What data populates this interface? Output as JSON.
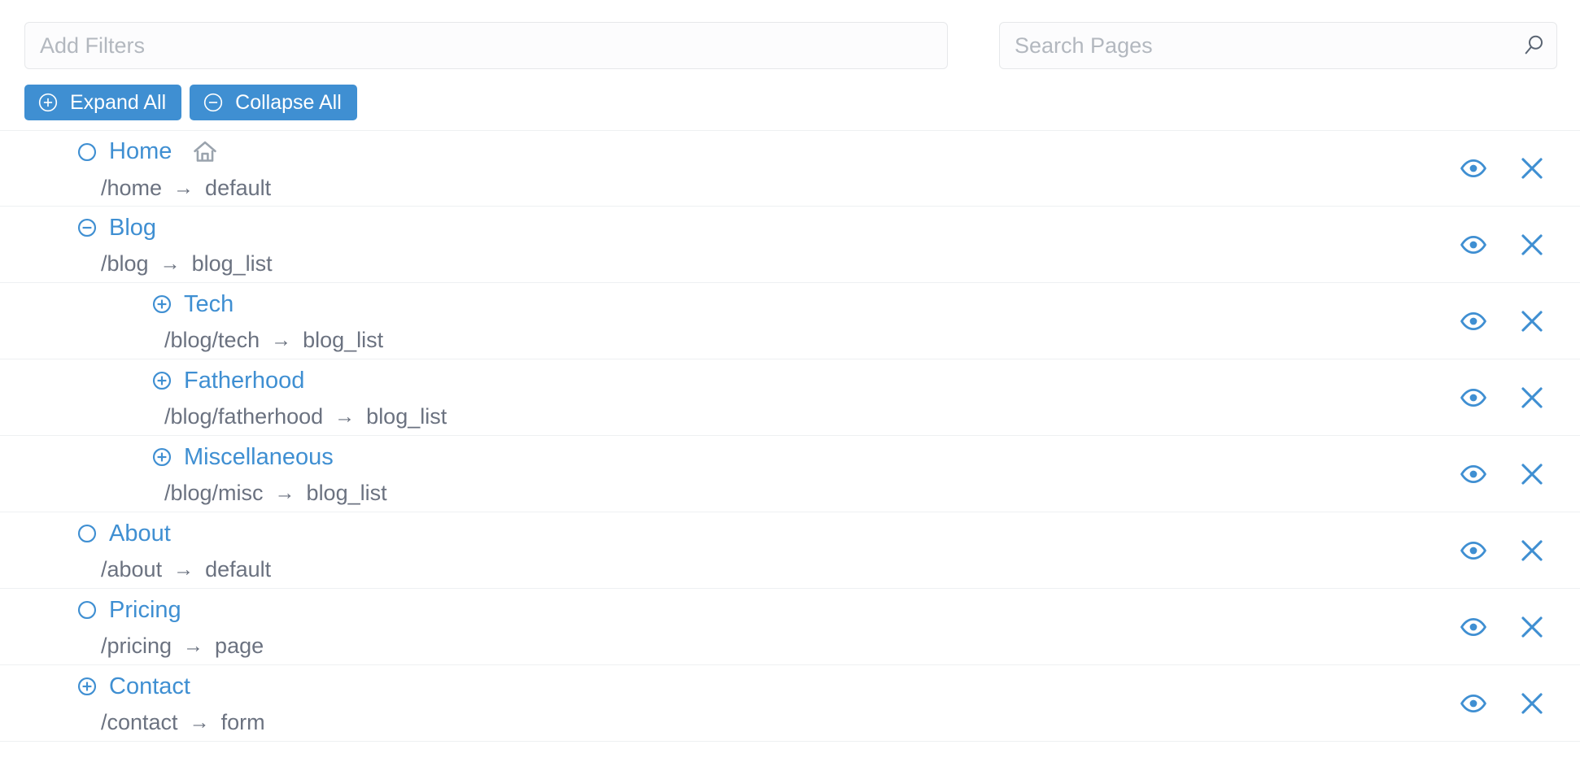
{
  "filters": {
    "placeholder": "Add Filters",
    "value": ""
  },
  "search": {
    "placeholder": "Search Pages",
    "value": "",
    "icon": "search-icon"
  },
  "buttons": {
    "expand_all": "Expand All",
    "collapse_all": "Collapse All",
    "expand_icon": "plus-circle-icon",
    "collapse_icon": "minus-circle-icon"
  },
  "colors": {
    "accent": "#3f8fd2",
    "link": "#3f8fd2",
    "muted_text": "#6b7280",
    "placeholder": "#b3b8bf",
    "row_border": "#eef0f2",
    "input_border": "#e6e8ea",
    "input_bg": "#fcfcfd"
  },
  "actions": {
    "view_icon": "eye-icon",
    "delete_icon": "close-x-icon"
  },
  "tree": {
    "arrow_glyph": "→",
    "rows": [
      {
        "name": "Home",
        "path": "/home",
        "template": "default",
        "depth": 0,
        "toggle": "circle-empty-icon",
        "has_home_icon": true
      },
      {
        "name": "Blog",
        "path": "/blog",
        "template": "blog_list",
        "depth": 0,
        "toggle": "minus-circle-icon",
        "has_home_icon": false
      },
      {
        "name": "Tech",
        "path": "/blog/tech",
        "template": "blog_list",
        "depth": 1,
        "toggle": "plus-circle-icon",
        "has_home_icon": false
      },
      {
        "name": "Fatherhood",
        "path": "/blog/fatherhood",
        "template": "blog_list",
        "depth": 1,
        "toggle": "plus-circle-icon",
        "has_home_icon": false
      },
      {
        "name": "Miscellaneous",
        "path": "/blog/misc",
        "template": "blog_list",
        "depth": 1,
        "toggle": "plus-circle-icon",
        "has_home_icon": false
      },
      {
        "name": "About",
        "path": "/about",
        "template": "default",
        "depth": 0,
        "toggle": "circle-empty-icon",
        "has_home_icon": false
      },
      {
        "name": "Pricing",
        "path": "/pricing",
        "template": "page",
        "depth": 0,
        "toggle": "circle-empty-icon",
        "has_home_icon": false
      },
      {
        "name": "Contact",
        "path": "/contact",
        "template": "form",
        "depth": 0,
        "toggle": "plus-circle-icon",
        "has_home_icon": false
      }
    ]
  }
}
